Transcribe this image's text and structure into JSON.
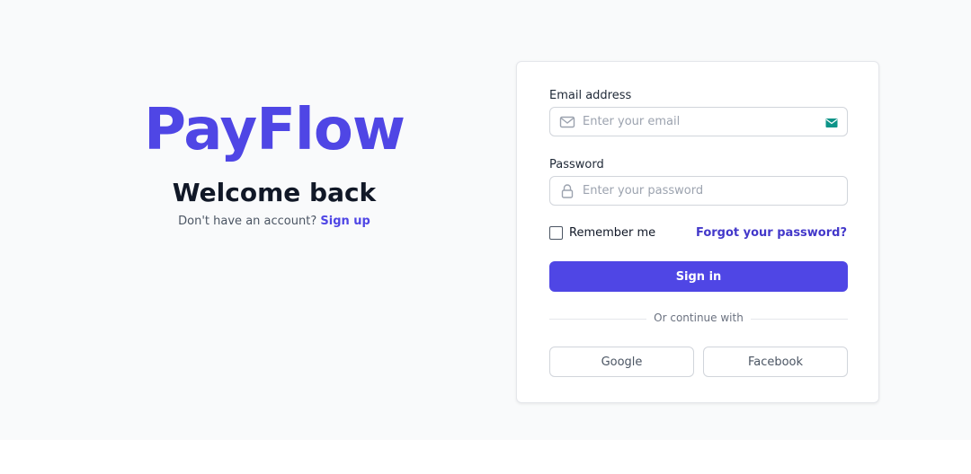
{
  "brand": {
    "logo": "PayFlow",
    "welcome": "Welcome back",
    "signup_prompt": "Don't have an account?",
    "signup_link": "Sign up"
  },
  "form": {
    "email_label": "Email address",
    "email_placeholder": "Enter your email",
    "email_value": "",
    "password_label": "Password",
    "password_placeholder": "Enter your password",
    "password_value": "",
    "remember_label": "Remember me",
    "remember_checked": false,
    "forgot_link": "Forgot your password?",
    "submit_label": "Sign in",
    "divider_text": "Or continue with",
    "social": [
      {
        "label": "Google"
      },
      {
        "label": "Facebook"
      }
    ]
  },
  "icons": {
    "email_lead": "envelope-icon",
    "email_trail": "autofill-envelope-icon",
    "password_lead": "lock-icon"
  },
  "colors": {
    "accent": "#4f46e5",
    "background": "#f9fafb",
    "autofill_icon": "#0d9488"
  }
}
